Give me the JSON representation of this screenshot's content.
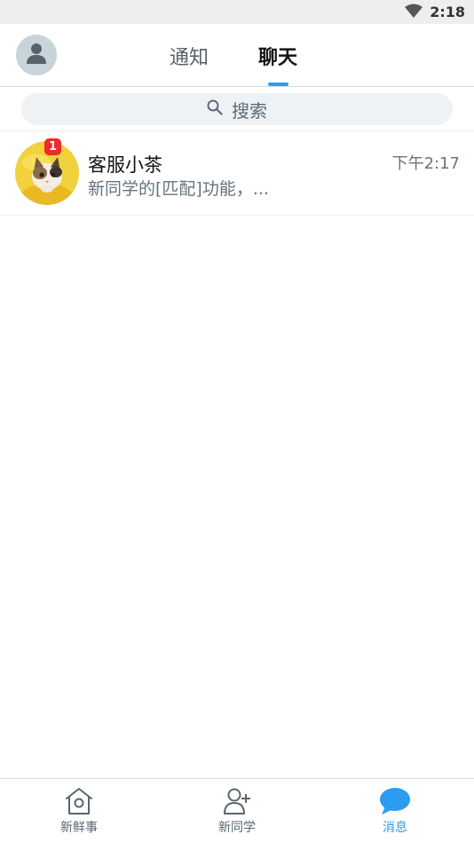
{
  "status_bar": {
    "time": "2:18",
    "icons": [
      "wifi-icon",
      "signal-icon"
    ]
  },
  "header": {
    "avatar_icon": "user-icon",
    "tabs": [
      {
        "label": "通知",
        "active": false
      },
      {
        "label": "聊天",
        "active": true
      }
    ]
  },
  "search": {
    "placeholder": "搜索",
    "icon": "search-icon"
  },
  "chats": [
    {
      "name": "客服小茶",
      "time": "下午2:17",
      "preview": "新同学的[匹配]功能，...",
      "unread": "1"
    }
  ],
  "bottom_nav": [
    {
      "label": "新鲜事",
      "icon": "house-icon",
      "active": false
    },
    {
      "label": "新同学",
      "icon": "add-user-icon",
      "active": false
    },
    {
      "label": "消息",
      "icon": "chat-bubble-icon",
      "active": true
    }
  ],
  "colors": {
    "accent": "#2b9cf2",
    "badge": "#ee2a2a",
    "status_bar": "#eeeeee",
    "search_bg": "#eef2f5"
  }
}
